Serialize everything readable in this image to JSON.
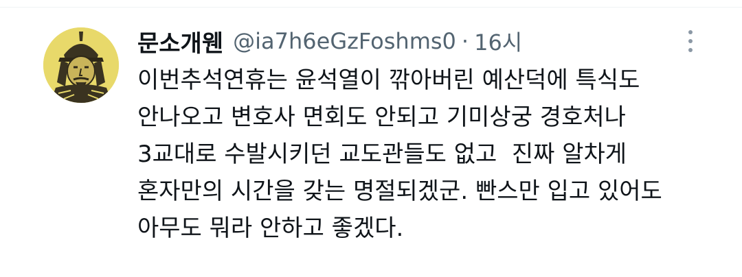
{
  "tweet": {
    "display_name": "문소개웬",
    "handle": "@ia7h6eGzFoshms0",
    "separator": "·",
    "time": "16시",
    "avatar_icon": "warrior-portrait-icon",
    "more_icon": "vertical-dots-icon",
    "lines": [
      "이번추석연휴는 윤석열이 깎아버린 예산덕에 특식도",
      "안나오고 변호사 면회도 안되고 기미상궁 경호처나",
      "3교대로 수발시키던 교도관들도 없고  진짜 알차게",
      "혼자만의 시간을 갖는 명절되겠군. 빤스만 입고 있어도",
      "아무도 뭐라 안하고 좋겠다."
    ]
  },
  "colors": {
    "avatar_bg": "#e8d96a",
    "text_primary": "#0f1419",
    "text_secondary": "#536471"
  }
}
